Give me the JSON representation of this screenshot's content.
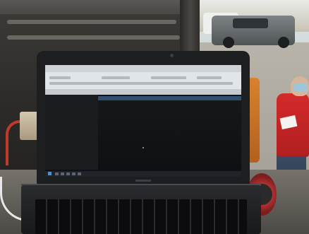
{
  "screen": {
    "app_title": ""
  },
  "colors": {
    "van_interior": "#3b3936",
    "laptop": "#1d1e20",
    "screen_dark": "#101114",
    "app_blue_header": "#2f4f70",
    "person_jacket": "#d42a2a",
    "truck": "#5f6466"
  }
}
